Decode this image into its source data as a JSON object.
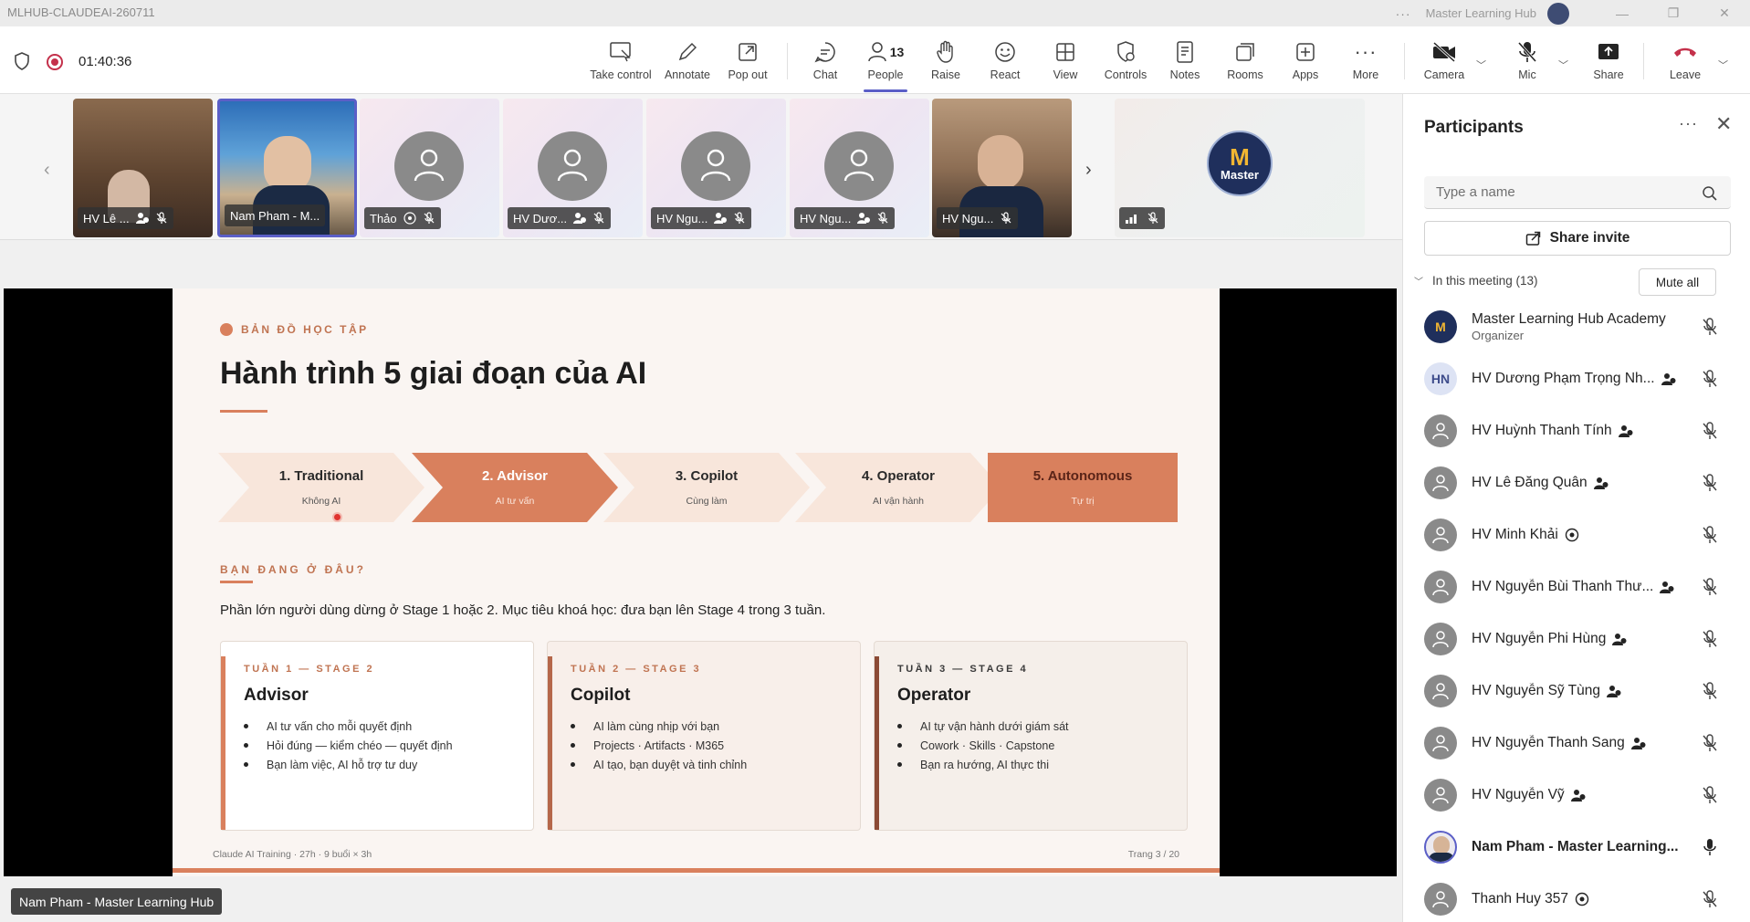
{
  "titlebar": {
    "title": "MLHUB-CLAUDEAI-260711",
    "org_name": "Master Learning Hub"
  },
  "toolbar": {
    "timer": "01:40:36",
    "tools": {
      "take_control": "Take control",
      "annotate": "Annotate",
      "pop_out": "Pop out",
      "chat": "Chat",
      "people": "People",
      "people_count": "13",
      "raise": "Raise",
      "react": "React",
      "view": "View",
      "controls": "Controls",
      "notes": "Notes",
      "rooms": "Rooms",
      "apps": "Apps",
      "more": "More",
      "camera": "Camera",
      "mic": "Mic",
      "share": "Share",
      "leave": "Leave"
    }
  },
  "gallery": {
    "tiles": [
      {
        "name": "HV Lê ..."
      },
      {
        "name": "Nam Pham - M..."
      },
      {
        "name": "Thảo"
      },
      {
        "name": "HV Dươ..."
      },
      {
        "name": "HV Ngu..."
      },
      {
        "name": "HV Ngu..."
      },
      {
        "name": "HV Ngu..."
      }
    ],
    "org_logo_text": "Master"
  },
  "slide": {
    "kicker": "BẢN ĐỒ HỌC TẬP",
    "title": "Hành trình 5 giai đoạn của AI",
    "stages": [
      {
        "title": "1. Traditional",
        "sub": "Không AI"
      },
      {
        "title": "2. Advisor",
        "sub": "AI tư vấn"
      },
      {
        "title": "3. Copilot",
        "sub": "Cùng làm"
      },
      {
        "title": "4. Operator",
        "sub": "AI vận hành"
      },
      {
        "title": "5. Autonomous",
        "sub": "Tự trị"
      }
    ],
    "section2": "BẠN ĐANG Ở ĐÂU?",
    "description": "Phần lớn người dùng dừng ở Stage 1 hoặc 2. Mục tiêu khoá học: đưa bạn lên Stage 4 trong 3 tuần.",
    "cards": [
      {
        "kicker": "TUẦN 1 — STAGE 2",
        "title": "Advisor",
        "items": [
          "AI tư vấn cho mỗi quyết định",
          "Hỏi đúng — kiểm chéo — quyết định",
          "Bạn làm việc, AI hỗ trợ tư duy"
        ]
      },
      {
        "kicker": "TUẦN 2 — STAGE 3",
        "title": "Copilot",
        "items": [
          "AI làm cùng nhịp với bạn",
          "Projects · Artifacts · M365",
          "AI tạo, bạn duyệt và tinh chỉnh"
        ]
      },
      {
        "kicker": "TUẦN 3 — STAGE 4",
        "title": "Operator",
        "items": [
          "AI tự vận hành dưới giám sát",
          "Cowork · Skills · Capstone",
          "Bạn ra hướng, AI thực thi"
        ]
      }
    ],
    "footer_left": "Claude AI Training · 27h · 9 buổi × 3h",
    "footer_right": "Trang 3 / 20"
  },
  "presenter_label": "Nam Pham - Master Learning Hub",
  "panel": {
    "title": "Participants",
    "search_placeholder": "Type a name",
    "share_invite": "Share invite",
    "section_label": "In this meeting (13)",
    "mute_all": "Mute all",
    "participants": [
      {
        "name": "Master Learning Hub Academy",
        "role": "Organizer"
      },
      {
        "name": "HV Dương Phạm Trọng Nh...",
        "initials": "HN"
      },
      {
        "name": "HV Huỳnh Thanh Tính"
      },
      {
        "name": "HV Lê Đăng Quân"
      },
      {
        "name": "HV Minh Khải"
      },
      {
        "name": "HV Nguyễn Bùi Thanh Thư..."
      },
      {
        "name": "HV Nguyễn Phi Hùng"
      },
      {
        "name": "HV Nguyễn Sỹ Tùng"
      },
      {
        "name": "HV Nguyễn Thanh Sang"
      },
      {
        "name": "HV Nguyễn Vỹ"
      },
      {
        "name": "Nam Pham - Master Learning..."
      },
      {
        "name": "Thanh Huy 357"
      }
    ]
  },
  "colors": {
    "accent": "#d9805d",
    "accent_dark": "#8b4a35",
    "teams_purple": "#5b5fc7",
    "leave_red": "#c4314b"
  }
}
